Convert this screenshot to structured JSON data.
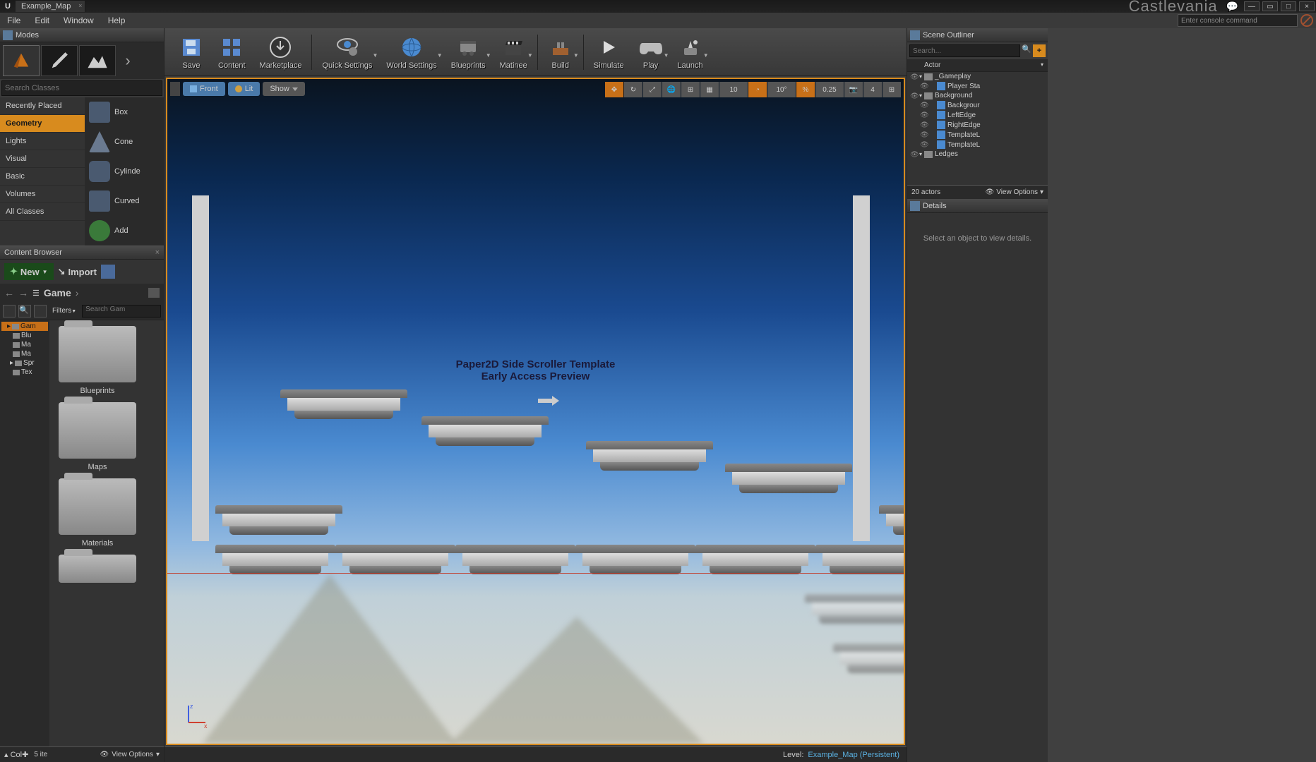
{
  "titlebar": {
    "tab": "Example_Map",
    "project": "Castlevania"
  },
  "menu": {
    "file": "File",
    "edit": "Edit",
    "window": "Window",
    "help": "Help",
    "console_placeholder": "Enter console command"
  },
  "modes": {
    "title": "Modes",
    "search_placeholder": "Search Classes",
    "cats": [
      "Recently Placed",
      "Geometry",
      "Lights",
      "Visual",
      "Basic",
      "Volumes",
      "All Classes"
    ],
    "items": [
      "Box",
      "Cone",
      "Cylinde",
      "Curved",
      "Add"
    ]
  },
  "toolbar": {
    "save": "Save",
    "content": "Content",
    "marketplace": "Marketplace",
    "quick": "Quick Settings",
    "world": "World Settings",
    "blueprints": "Blueprints",
    "matinee": "Matinee",
    "build": "Build",
    "simulate": "Simulate",
    "play": "Play",
    "launch": "Launch"
  },
  "viewport": {
    "front": "Front",
    "lit": "Lit",
    "show": "Show",
    "snap_loc": "10",
    "snap_rot": "10°",
    "snap_scale": "0.25",
    "cam_speed": "4",
    "title_line1": "Paper2D Side Scroller Template",
    "title_line2": "Early Access Preview"
  },
  "content_browser": {
    "title": "Content Browser",
    "new": "New",
    "import": "Import",
    "crumb": "Game",
    "filters": "Filters",
    "search_placeholder": "Search Gam",
    "tree": [
      "Gam",
      "Blu",
      "Ma",
      "Ma",
      "Spr",
      "Tex"
    ],
    "assets": [
      "Blueprints",
      "Maps",
      "Materials"
    ],
    "collections": "Col",
    "count": "5 ite",
    "view_options": "View Options"
  },
  "outliner": {
    "title": "Scene Outliner",
    "search_placeholder": "Search...",
    "header": "Actor",
    "nodes": [
      {
        "indent": 0,
        "tri": "▾",
        "type": "folder",
        "label": "_Gameplay"
      },
      {
        "indent": 1,
        "tri": "",
        "type": "actor",
        "label": "Player Sta"
      },
      {
        "indent": 0,
        "tri": "▾",
        "type": "folder",
        "label": "Background"
      },
      {
        "indent": 1,
        "tri": "",
        "type": "actor",
        "label": "Backgrour"
      },
      {
        "indent": 1,
        "tri": "",
        "type": "actor",
        "label": "LeftEdge"
      },
      {
        "indent": 1,
        "tri": "",
        "type": "actor",
        "label": "RightEdge"
      },
      {
        "indent": 1,
        "tri": "",
        "type": "actor",
        "label": "TemplateL"
      },
      {
        "indent": 1,
        "tri": "",
        "type": "actor",
        "label": "TemplateL"
      },
      {
        "indent": 0,
        "tri": "▾",
        "type": "folder",
        "label": "Ledges"
      }
    ],
    "count": "20 actors",
    "view_options": "View Options"
  },
  "details": {
    "title": "Details",
    "empty": "Select an object to view details."
  },
  "status": {
    "level_label": "Level:",
    "level": "Example_Map (Persistent)"
  }
}
